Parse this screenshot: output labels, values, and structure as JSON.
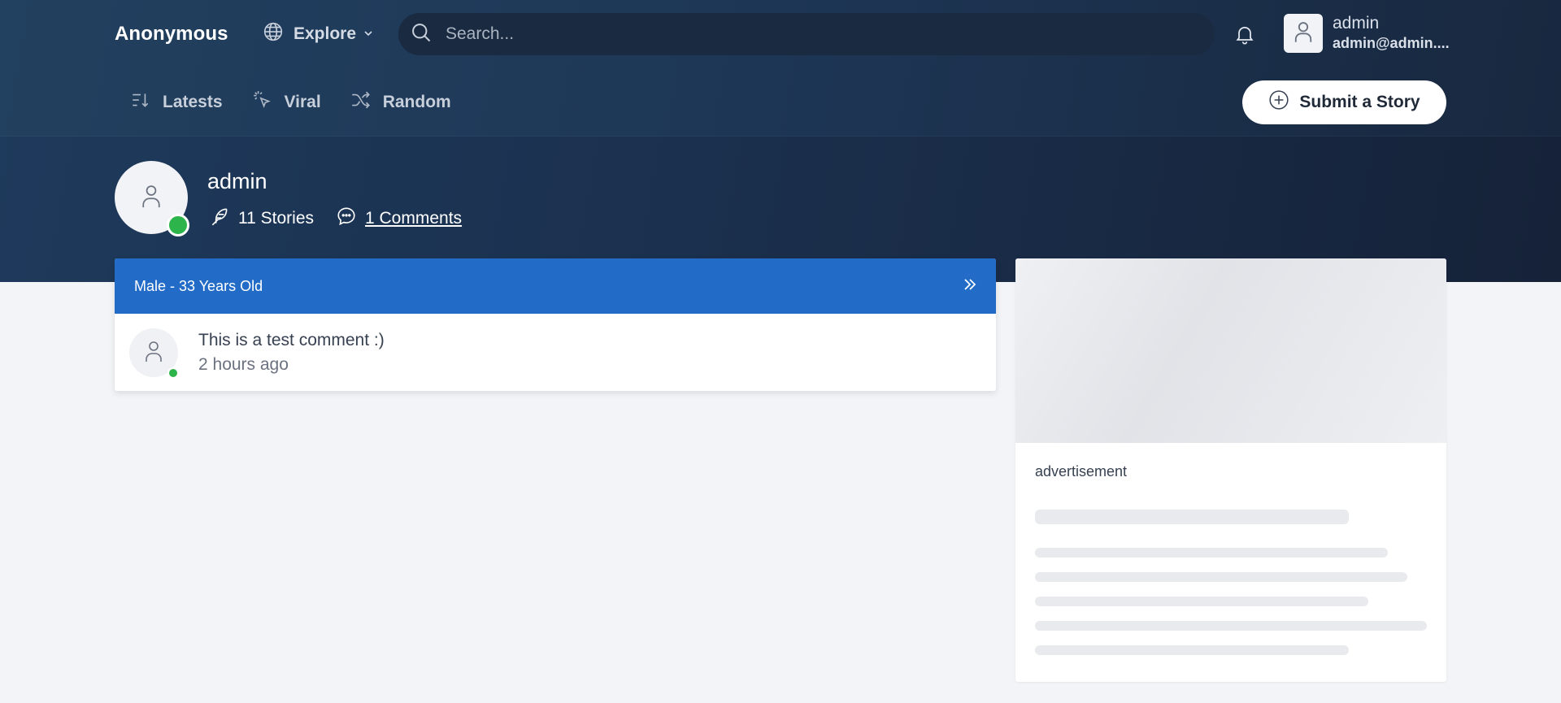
{
  "header": {
    "brand": "Anonymous",
    "explore_label": "Explore",
    "search_placeholder": "Search...",
    "user": {
      "name": "admin",
      "email": "admin@admin...."
    }
  },
  "nav": {
    "items": [
      {
        "label": "Latests",
        "icon": "sort-descending-icon"
      },
      {
        "label": "Viral",
        "icon": "click-burst-icon"
      },
      {
        "label": "Random",
        "icon": "shuffle-icon"
      }
    ],
    "submit_label": "Submit a Story"
  },
  "profile": {
    "name": "admin",
    "stories": "11 Stories",
    "comments": "1 Comments",
    "status": "online"
  },
  "story_card": {
    "header": "Male - 33 Years Old",
    "comment": {
      "text": "This is a test comment :)",
      "time": "2 hours ago"
    }
  },
  "ad": {
    "label": "advertisement"
  },
  "colors": {
    "accent": "#226bc7",
    "online": "#2db44a",
    "header_bg": "#1e3757"
  }
}
